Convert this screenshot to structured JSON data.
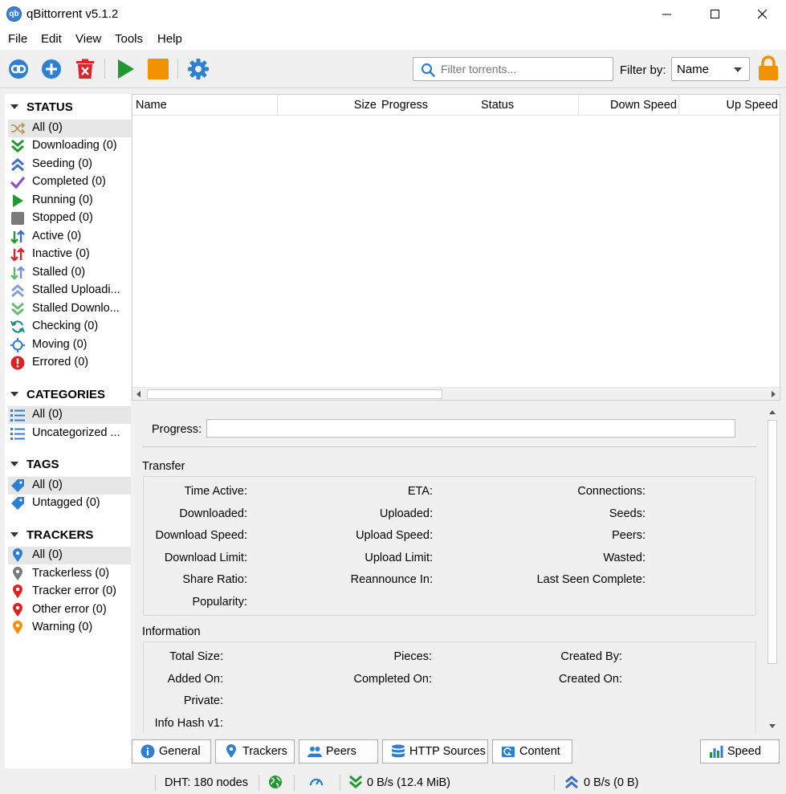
{
  "window": {
    "title": "qBittorrent v5.1.2",
    "app_icon_text": "qb"
  },
  "menu": [
    "File",
    "Edit",
    "View",
    "Tools",
    "Help"
  ],
  "toolbar": {
    "search_placeholder": "Filter torrents...",
    "filter_label": "Filter by:",
    "filter_value": "Name"
  },
  "sidebar": {
    "status": {
      "title": "STATUS",
      "items": [
        "All (0)",
        "Downloading (0)",
        "Seeding (0)",
        "Completed (0)",
        "Running (0)",
        "Stopped (0)",
        "Active (0)",
        "Inactive (0)",
        "Stalled (0)",
        "Stalled Uploadi...",
        "Stalled Downlo...",
        "Checking (0)",
        "Moving (0)",
        "Errored (0)"
      ]
    },
    "categories": {
      "title": "CATEGORIES",
      "items": [
        "All (0)",
        "Uncategorized ..."
      ]
    },
    "tags": {
      "title": "TAGS",
      "items": [
        "All (0)",
        "Untagged (0)"
      ]
    },
    "trackers": {
      "title": "TRACKERS",
      "items": [
        "All (0)",
        "Trackerless (0)",
        "Tracker error (0)",
        "Other error (0)",
        "Warning (0)"
      ]
    }
  },
  "columns": [
    "Name",
    "Size",
    "Progress",
    "Status",
    "Down Speed",
    "Up Speed"
  ],
  "properties": {
    "progress_label": "Progress:",
    "transfer": {
      "title": "Transfer",
      "col1": [
        "Time Active:",
        "Downloaded:",
        "Download Speed:",
        "Download Limit:",
        "Share Ratio:",
        "Popularity:"
      ],
      "col2": [
        "ETA:",
        "Uploaded:",
        "Upload Speed:",
        "Upload Limit:",
        "Reannounce In:"
      ],
      "col3": [
        "Connections:",
        "Seeds:",
        "Peers:",
        "Wasted:",
        "Last Seen Complete:"
      ]
    },
    "information": {
      "title": "Information",
      "col1": [
        "Total Size:",
        "Added On:",
        "Private:",
        "Info Hash v1:"
      ],
      "col2": [
        "Pieces:",
        "Completed On:"
      ],
      "col3": [
        "Created By:",
        "Created On:"
      ]
    }
  },
  "tabs": [
    "General",
    "Trackers",
    "Peers",
    "HTTP Sources",
    "Content"
  ],
  "speed_button": "Speed",
  "statusbar": {
    "dht": "DHT: 180 nodes",
    "download": "0 B/s (12.4 MiB)",
    "upload": "0 B/s (0 B)"
  },
  "colors": {
    "blue": "#2d7fd3",
    "red": "#d9252b",
    "green": "#1f9a2e",
    "orange": "#f39200",
    "purple": "#8a4fcf"
  }
}
